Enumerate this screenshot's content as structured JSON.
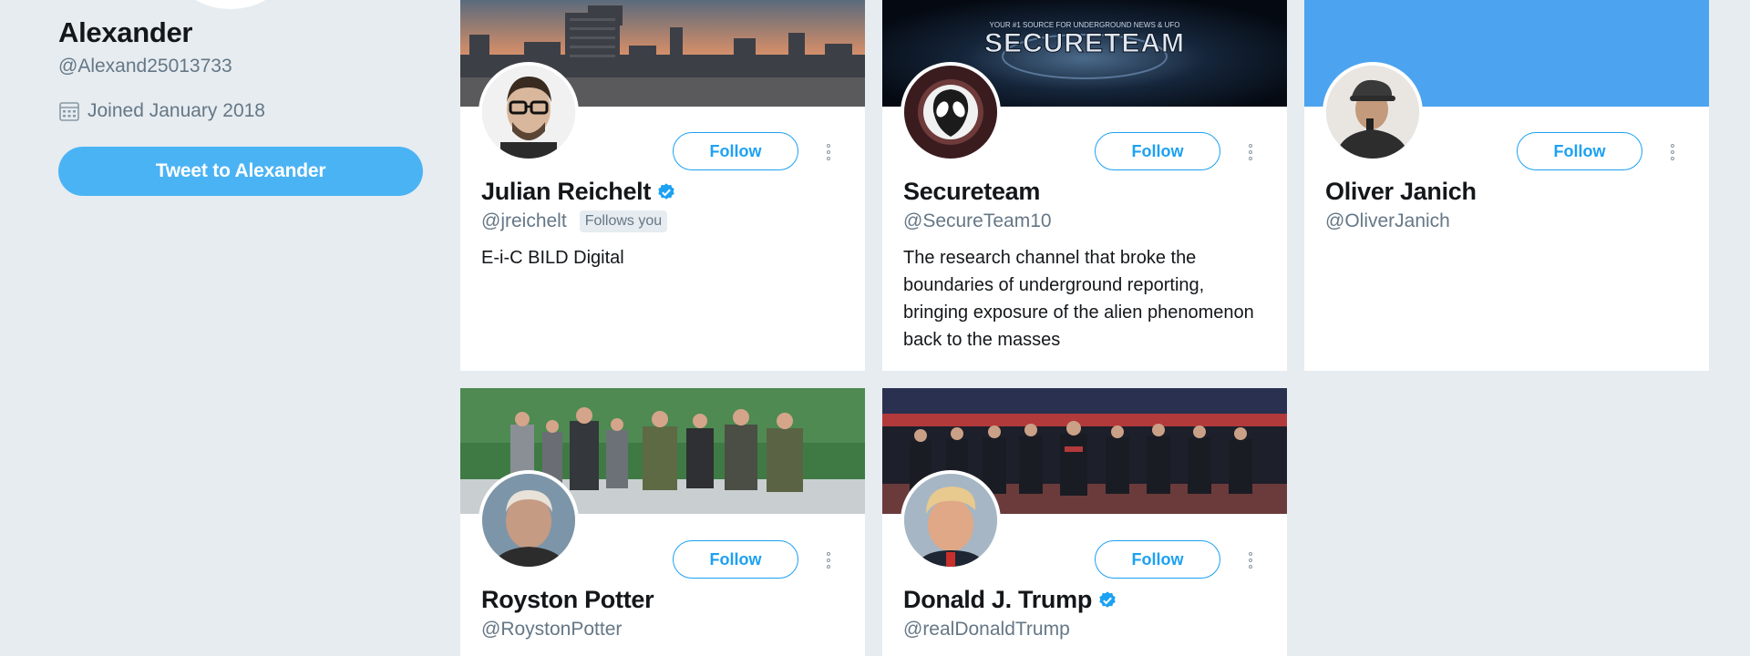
{
  "theme": {
    "page_bg": "#e6ecf0",
    "accent": "#1da1f2",
    "button_fill": "#4ab3f4",
    "verified": "#1da1f2"
  },
  "profile": {
    "name": "Alexander",
    "handle": "@Alexand25013733",
    "joined": "Joined January 2018",
    "tweet_button_label": "Tweet to Alexander"
  },
  "cards": [
    {
      "name": "Julian Reichelt",
      "verified": true,
      "handle": "@jreichelt",
      "follows_you": "Follows you",
      "bio": "E-i-C BILD Digital",
      "follow_label": "Follow",
      "banner": "city-skyline-sunset"
    },
    {
      "name": "Secureteam",
      "verified": false,
      "handle": "@SecureTeam10",
      "bio": "The research channel that broke the boundaries of underground reporting, bringing exposure of the alien phenomenon back to the masses",
      "follow_label": "Follow",
      "banner_title": "SECURETEAM",
      "banner_tagline": "YOUR #1 SOURCE FOR UNDERGROUND NEWS & UFO"
    },
    {
      "name": "Oliver Janich",
      "verified": false,
      "handle": "@OliverJanich",
      "follow_label": "Follow",
      "banner": "solid-blue"
    },
    {
      "name": "Royston Potter",
      "verified": false,
      "handle": "@RoystonPotter",
      "follow_label": "Follow",
      "banner": "group-photo-helicopter"
    },
    {
      "name": "Donald J. Trump",
      "verified": true,
      "handle": "@realDonaldTrump",
      "follow_label": "Follow",
      "banner": "stadium-salute"
    }
  ]
}
